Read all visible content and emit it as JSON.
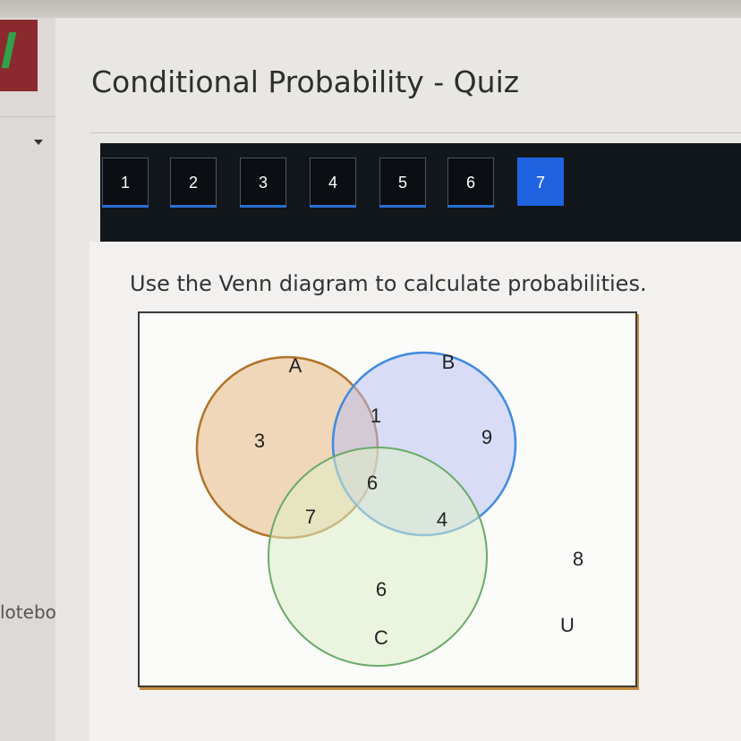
{
  "sidebar": {
    "notebook_label": "lotebo..."
  },
  "header": {
    "title": "Conditional Probability - Quiz"
  },
  "nav": {
    "buttons": [
      "1",
      "2",
      "3",
      "4",
      "5",
      "6",
      "7"
    ],
    "active": "7"
  },
  "question": {
    "prompt": "Use the Venn diagram to calculate probabilities."
  },
  "venn": {
    "sets": {
      "A": "A",
      "B": "B",
      "C": "C",
      "U": "U"
    },
    "regions": {
      "a_only": "3",
      "a_b": "1",
      "b_only": "9",
      "a_b_c": "6",
      "a_c": "7",
      "b_c": "4",
      "c_only": "6",
      "outside": "8"
    },
    "colors": {
      "A": "#c98a3c",
      "B": "#4a90e2",
      "C": "#6fb06b"
    }
  }
}
